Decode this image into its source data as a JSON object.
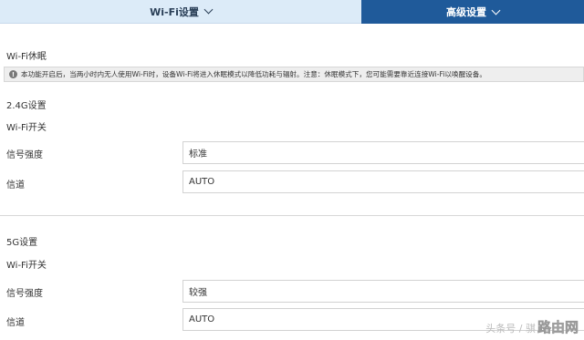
{
  "tabs": {
    "wifi_settings": "Wi-Fi设置",
    "advanced_settings": "高级设置"
  },
  "sleep": {
    "title": "Wi-Fi休眠",
    "notice": "本功能开启后，当两小时内无人使用Wi-Fi时，设备Wi-Fi将进入休眠模式以降低功耗与辐射。注意：休眠模式下，您可能需要靠近连接Wi-Fi以唤醒设备。"
  },
  "band_24g": {
    "title": "2.4G设置",
    "switch_label": "Wi-Fi开关",
    "signal_label": "信号强度",
    "signal_value": "标准",
    "channel_label": "信道",
    "channel_value": "AUTO"
  },
  "band_5g": {
    "title": "5G设置",
    "switch_label": "Wi-Fi开关",
    "signal_label": "信号强度",
    "signal_value": "较强",
    "channel_label": "信道",
    "channel_value": "AUTO"
  },
  "watermark": {
    "source": "头条号 / 骐",
    "site": "路由网"
  },
  "colors": {
    "active_tab_bg": "#1f5a9a",
    "inactive_tab_bg": "#dcebf8",
    "notice_bg": "#eeeeee"
  }
}
